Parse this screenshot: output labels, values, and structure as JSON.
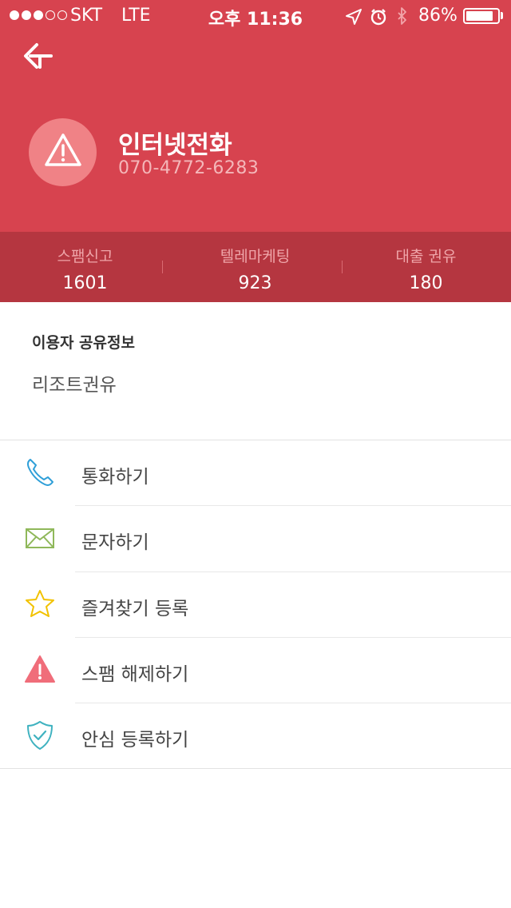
{
  "status_bar": {
    "carrier": "SKT",
    "network": "LTE",
    "time": "오후 11:36",
    "battery": "86%",
    "battery_level": 0.86,
    "signal_bars": 3,
    "signal_total": 5
  },
  "caller": {
    "name": "인터넷전화",
    "number": "070-4772-6283",
    "icon": "warning-icon"
  },
  "stats": [
    {
      "label": "스팸신고",
      "value": "1601"
    },
    {
      "label": "텔레마케팅",
      "value": "923"
    },
    {
      "label": "대출 권유",
      "value": "180"
    }
  ],
  "user_info": {
    "title": "이용자 공유정보",
    "text": "리조트권유"
  },
  "actions": [
    {
      "label": "통화하기",
      "icon": "phone-icon",
      "color": "#2f9fd8"
    },
    {
      "label": "문자하기",
      "icon": "envelope-icon",
      "color": "#8fb85a"
    },
    {
      "label": "즐겨찾기 등록",
      "icon": "star-icon",
      "color": "#f2c200"
    },
    {
      "label": "스팸 해제하기",
      "icon": "warning-icon",
      "color": "#f06d7a"
    },
    {
      "label": "안심 등록하기",
      "icon": "shield-check-icon",
      "color": "#3fb2c0"
    }
  ],
  "colors": {
    "header": "#d7434f",
    "stats_bar": "#b53640",
    "avatar": "#f08286"
  }
}
